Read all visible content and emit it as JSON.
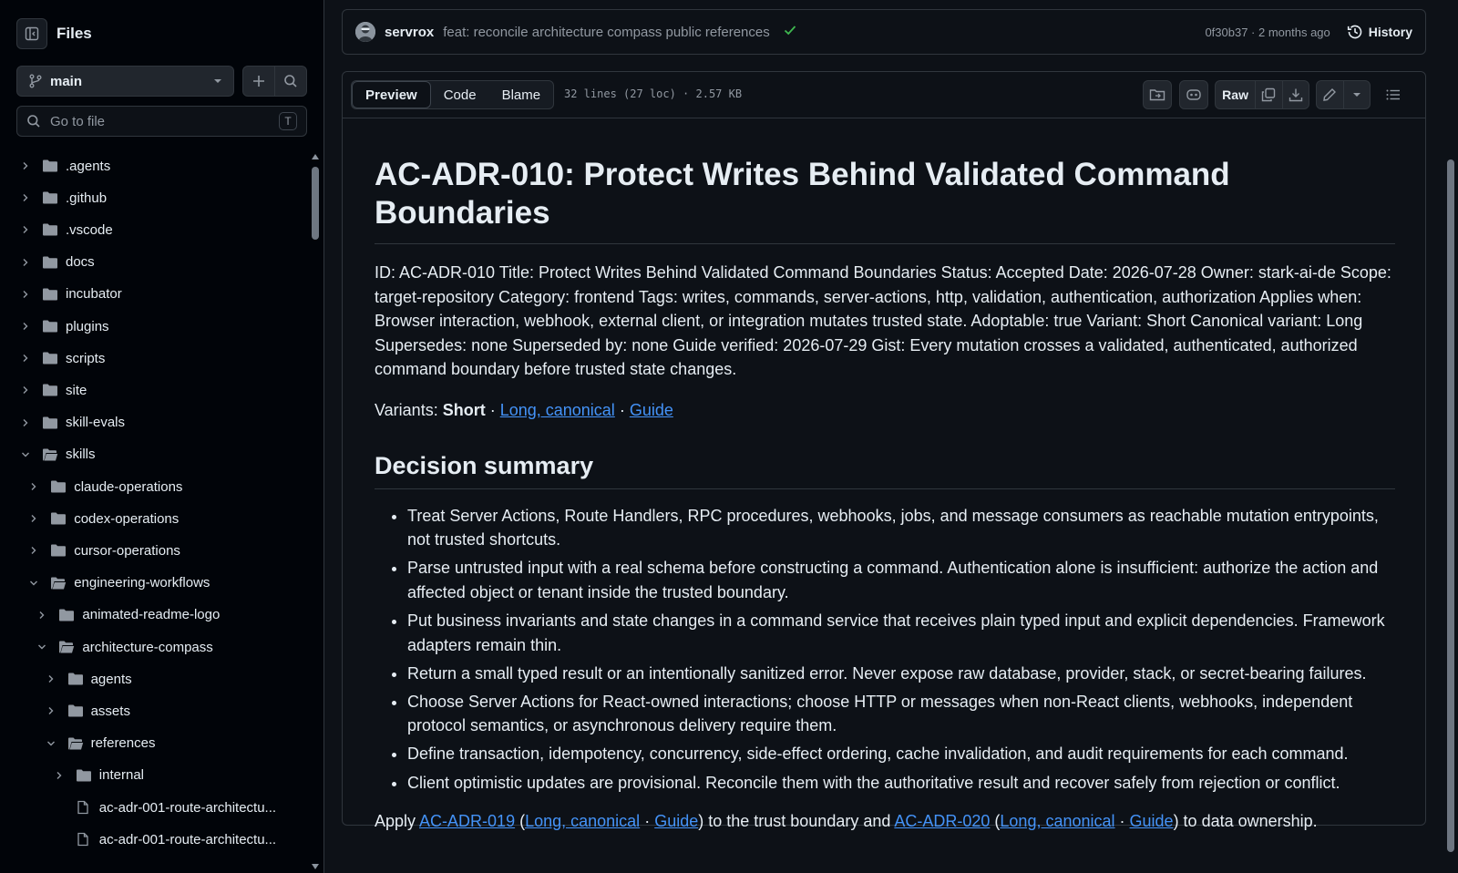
{
  "sidebar": {
    "title": "Files",
    "branch": "main",
    "goto_placeholder": "Go to file",
    "goto_shortcut": "T",
    "tree": [
      {
        "name": ".agents",
        "type": "folder",
        "depth": 0,
        "expanded": false
      },
      {
        "name": ".github",
        "type": "folder",
        "depth": 0,
        "expanded": false
      },
      {
        "name": ".vscode",
        "type": "folder",
        "depth": 0,
        "expanded": false
      },
      {
        "name": "docs",
        "type": "folder",
        "depth": 0,
        "expanded": false
      },
      {
        "name": "incubator",
        "type": "folder",
        "depth": 0,
        "expanded": false
      },
      {
        "name": "plugins",
        "type": "folder",
        "depth": 0,
        "expanded": false
      },
      {
        "name": "scripts",
        "type": "folder",
        "depth": 0,
        "expanded": false
      },
      {
        "name": "site",
        "type": "folder",
        "depth": 0,
        "expanded": false
      },
      {
        "name": "skill-evals",
        "type": "folder",
        "depth": 0,
        "expanded": false
      },
      {
        "name": "skills",
        "type": "folder",
        "depth": 0,
        "expanded": true
      },
      {
        "name": "claude-operations",
        "type": "folder",
        "depth": 1,
        "expanded": false
      },
      {
        "name": "codex-operations",
        "type": "folder",
        "depth": 1,
        "expanded": false
      },
      {
        "name": "cursor-operations",
        "type": "folder",
        "depth": 1,
        "expanded": false
      },
      {
        "name": "engineering-workflows",
        "type": "folder",
        "depth": 1,
        "expanded": true
      },
      {
        "name": "animated-readme-logo",
        "type": "folder",
        "depth": 2,
        "expanded": false
      },
      {
        "name": "architecture-compass",
        "type": "folder",
        "depth": 2,
        "expanded": true
      },
      {
        "name": "agents",
        "type": "folder",
        "depth": 3,
        "expanded": false
      },
      {
        "name": "assets",
        "type": "folder",
        "depth": 3,
        "expanded": false
      },
      {
        "name": "references",
        "type": "folder",
        "depth": 3,
        "expanded": true
      },
      {
        "name": "internal",
        "type": "folder",
        "depth": 4,
        "expanded": false
      },
      {
        "name": "ac-adr-001-route-architectu...",
        "type": "file",
        "depth": 4
      },
      {
        "name": "ac-adr-001-route-architectu...",
        "type": "file",
        "depth": 4
      }
    ]
  },
  "commit": {
    "author": "servrox",
    "message": "feat: reconcile architecture compass public references",
    "meta": "0f30b37 · 2 months ago",
    "history_label": "History"
  },
  "file": {
    "tabs": [
      "Preview",
      "Code",
      "Blame"
    ],
    "active_tab": "Preview",
    "stats": "32 lines (27 loc) · 2.57 KB",
    "raw_label": "Raw"
  },
  "doc": {
    "title": "AC-ADR-010: Protect Writes Behind Validated Command Boundaries",
    "metadata": "ID: AC-ADR-010 Title: Protect Writes Behind Validated Command Boundaries Status: Accepted Date: 2026-07-28 Owner: stark-ai-de Scope: target-repository Category: frontend Tags: writes, commands, server-actions, http, validation, authentication, authorization Applies when: Browser interaction, webhook, external client, or integration mutates trusted state. Adoptable: true Variant: Short Canonical variant: Long Supersedes: none Superseded by: none Guide verified: 2026-07-29 Gist: Every mutation crosses a validated, authenticated, authorized command boundary before trusted state changes.",
    "variants_prefix": "Variants: ",
    "variants_current": "Short",
    "sep": " · ",
    "link_long_canonical": "Long, canonical",
    "link_guide": "Guide",
    "summary_heading": "Decision summary",
    "bullets": [
      "Treat Server Actions, Route Handlers, RPC procedures, webhooks, jobs, and message consumers as reachable mutation entrypoints, not trusted shortcuts.",
      "Parse untrusted input with a real schema before constructing a command. Authentication alone is insufficient: authorize the action and affected object or tenant inside the trusted boundary.",
      "Put business invariants and state changes in a command service that receives plain typed input and explicit dependencies. Framework adapters remain thin.",
      "Return a small typed result or an intentionally sanitized error. Never expose raw database, provider, stack, or secret-bearing failures.",
      "Choose Server Actions for React-owned interactions; choose HTTP or messages when non-React clients, webhooks, independent protocol semantics, or asynchronous delivery require them.",
      "Define transaction, idempotency, concurrency, side-effect ordering, cache invalidation, and audit requirements for each command.",
      "Client optimistic updates are provisional. Reconcile them with the authoritative result and recover safely from rejection or conflict."
    ],
    "apply": {
      "prefix": "Apply ",
      "adr019": "AC-ADR-019",
      "open_paren": " (",
      "close_mid": ") to the trust boundary and ",
      "adr020": "AC-ADR-020",
      "close_end": ") to data ownership."
    }
  },
  "colors": {
    "bg": "#0d1117",
    "sidebar_bg": "#010409",
    "border": "#30363d",
    "text": "#e6edf3",
    "muted": "#9198a1",
    "link": "#4493f8",
    "success": "#3fb950"
  }
}
